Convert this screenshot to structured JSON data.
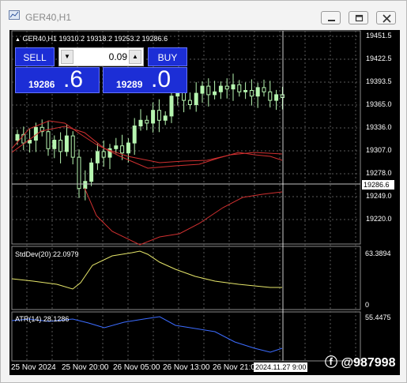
{
  "window": {
    "title": "GER40,H1"
  },
  "header": {
    "symbol_info": "GER40,H1  19310.2 19318.2 19253.2 19286.6"
  },
  "trade_panel": {
    "sell_label": "SELL",
    "buy_label": "BUY",
    "lot_value": "0.09",
    "sell_price_small": "19286",
    "sell_price_big": ".6",
    "buy_price_small": "19289",
    "buy_price_big": ".0"
  },
  "price_scale": [
    "19451.5",
    "19422.5",
    "19393.5",
    "19365.0",
    "19336.0",
    "19307.0",
    "19278.0",
    "19249.0",
    "19220.0"
  ],
  "current_price": "19286.6",
  "stddev": {
    "label": "StdDev(20) 22.0979",
    "max": "63.3894",
    "min": "0",
    "color": "#e6e66a"
  },
  "atr": {
    "label": "ATR(14) 28.1286",
    "max": "55.4475",
    "color": "#3c6cff"
  },
  "time_axis": [
    "25 Nov 2024",
    "25 Nov 20:00",
    "26 Nov 05:00",
    "26 Nov 13:00",
    "26 Nov 21:00"
  ],
  "cursor_time": "2024.11.27 9:00",
  "watermark": "@987998",
  "colors": {
    "bull": "#b6f5b0",
    "band": "#d03030",
    "background": "#000000"
  }
}
